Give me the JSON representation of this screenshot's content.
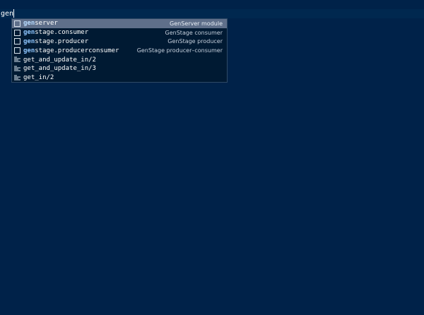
{
  "editor": {
    "typed_text": "gen",
    "colors": {
      "background": "#002249",
      "suggest_background": "#001a33",
      "selected_row": "#5f6f8a",
      "match_highlight": "#8fc6ff"
    }
  },
  "suggestions": {
    "items": [
      {
        "match": "gen",
        "rest": "server",
        "detail": "GenServer module",
        "icon": "module-icon",
        "selected": true
      },
      {
        "match": "gen",
        "rest": "stage.consumer",
        "detail": "GenStage consumer",
        "icon": "module-icon",
        "selected": false
      },
      {
        "match": "gen",
        "rest": "stage.producer",
        "detail": "GenStage producer",
        "icon": "module-icon",
        "selected": false
      },
      {
        "match": "gen",
        "rest": "stage.producerconsumer",
        "detail": "GenStage producer–consumer",
        "icon": "module-icon",
        "selected": false
      },
      {
        "match": "",
        "rest": "get_and_update_in/2",
        "detail": "",
        "icon": "function-icon",
        "selected": false
      },
      {
        "match": "",
        "rest": "get_and_update_in/3",
        "detail": "",
        "icon": "function-icon",
        "selected": false
      },
      {
        "match": "",
        "rest": "get_in/2",
        "detail": "",
        "icon": "function-icon",
        "selected": false
      }
    ]
  }
}
